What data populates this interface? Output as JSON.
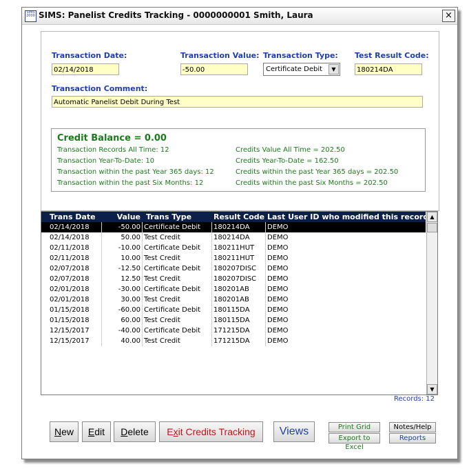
{
  "window": {
    "icon_text": "SIMS 2000",
    "title": "SIMS: Panelist Credits Tracking - 0000000001  Smith, Laura",
    "close_glyph": "×"
  },
  "form": {
    "transaction_date_label": "Transaction Date:",
    "transaction_date_value": "02/14/2018",
    "transaction_value_label": "Transaction Value:",
    "transaction_value_value": "-50.00",
    "transaction_type_label": "Transaction Type:",
    "transaction_type_value": "Certificate Debit",
    "test_result_code_label": "Test Result Code:",
    "test_result_code_value": "180214DA",
    "comment_label": "Transaction Comment:",
    "comment_value": "Automatic Panelist Debit During Test"
  },
  "balance": {
    "title": "Credit Balance = 0.00",
    "left": [
      "Transaction Records All Time: 12",
      "Transaction Year-To-Date: 10",
      "Transaction within the past Year 365 days: 12",
      "Transaction within the past Six Months: 12"
    ],
    "right": [
      "Credits Value All Time = 202.50",
      "Credits Year-To-Date = 162.50",
      "Credits within the past Year 365 days = 202.50",
      "Credits within the past Six Months = 202.50"
    ],
    "color": "#1a7a1a"
  },
  "grid": {
    "headers": [
      "Trans Date",
      "Value",
      "Trans Type",
      "Result Code",
      "Last User ID who modified this record"
    ],
    "rows": [
      [
        "02/14/2018",
        "-50.00",
        "Certificate Debit",
        "180214DA",
        "DEMO"
      ],
      [
        "02/14/2018",
        "50.00",
        "Test Credit",
        "180214DA",
        "DEMO"
      ],
      [
        "02/11/2018",
        "-10.00",
        "Certificate Debit",
        "180211HUT",
        "DEMO"
      ],
      [
        "02/11/2018",
        "10.00",
        "Test Credit",
        "180211HUT",
        "DEMO"
      ],
      [
        "02/07/2018",
        "-12.50",
        "Certificate Debit",
        "180207DISC",
        "DEMO"
      ],
      [
        "02/07/2018",
        "12.50",
        "Test Credit",
        "180207DISC",
        "DEMO"
      ],
      [
        "02/01/2018",
        "-30.00",
        "Certificate Debit",
        "180201AB",
        "DEMO"
      ],
      [
        "02/01/2018",
        "30.00",
        "Test Credit",
        "180201AB",
        "DEMO"
      ],
      [
        "01/15/2018",
        "-60.00",
        "Certificate Debit",
        "180115DA",
        "DEMO"
      ],
      [
        "01/15/2018",
        "60.00",
        "Test Credit",
        "180115DA",
        "DEMO"
      ],
      [
        "12/15/2017",
        "-40.00",
        "Certificate Debit",
        "171215DA",
        "DEMO"
      ],
      [
        "12/15/2017",
        "40.00",
        "Test Credit",
        "171215DA",
        "DEMO"
      ]
    ],
    "records_label": "Records: 12",
    "header_bg": "#0b1f4a"
  },
  "buttons": {
    "new_rest": "ew",
    "new_u": "N",
    "edit_u": "E",
    "edit_rest": "dit",
    "delete_u": "D",
    "delete_rest": "elete",
    "exit_pre": "E",
    "exit_u": "x",
    "exit_rest": "it Credits Tracking",
    "views": "Views",
    "print_grid": "Print Grid",
    "export_excel": "Export to Excel",
    "notes_help": "Notes/Help",
    "reports": "Reports"
  },
  "colors": {
    "label_blue": "#1e3fa8",
    "field_yellow": "#ffffc6",
    "exit_red": "#c0141a",
    "views_blue": "#1e3fa8"
  }
}
